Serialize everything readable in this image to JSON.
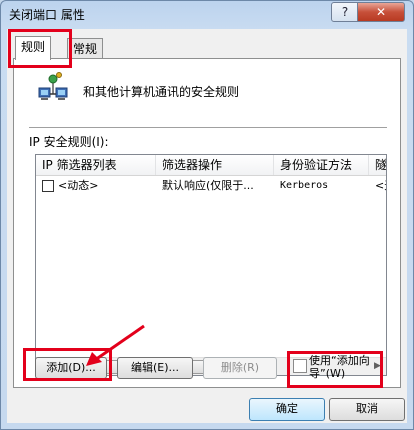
{
  "window": {
    "title": "关闭端口 属性",
    "help_label": "?",
    "close_label": "✕"
  },
  "tabs": [
    {
      "label": "规则"
    },
    {
      "label": "常规"
    }
  ],
  "header": {
    "description": "和其他计算机通讯的安全规则",
    "icon": "network-computers-icon"
  },
  "rules": {
    "label": "IP 安全规则(I):",
    "columns": [
      "IP 筛选器列表",
      "筛选器操作",
      "身份验证方法",
      "隧"
    ],
    "rows": [
      {
        "filter_list": "<动态>",
        "filter_action": "默认响应(仅限于...",
        "auth_method": "Kerberos",
        "tunnel": "<无"
      }
    ]
  },
  "buttons": {
    "add": "添加(D)...",
    "edit": "编辑(E)...",
    "delete": "删除(R)",
    "use_wizard": "使用“添加向导”(W)",
    "ok": "确定",
    "cancel": "取消"
  },
  "colors": {
    "highlight": "#e3001b"
  }
}
